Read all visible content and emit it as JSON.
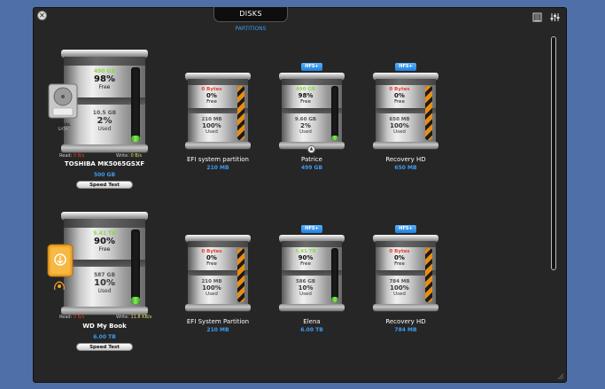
{
  "header": {
    "tab_disks": "DISKS",
    "tab_partitions": "PARTITIONS"
  },
  "colors": {
    "accent_blue": "#3e9bf0",
    "free_green": "#8cd84a",
    "warn_red": "#e04030",
    "stripe_orange": "#e88d14"
  },
  "icons": [
    "close-icon",
    "list-view-icon",
    "sliders-icon",
    "eject-icon",
    "hard-drive-icon",
    "external-drive-icon"
  ],
  "disks": [
    {
      "free_size": "490 GB",
      "free_pct": "98%",
      "free_word": "Free",
      "used_size": "10.5 GB",
      "used_pct": "2%",
      "used_word": "Used",
      "fill_level": 0.02,
      "icon_label_1": "SERIAL",
      "icon_label_2": "SATA",
      "read_label": "Read:",
      "read_value": "0 B/s",
      "write_label": "Write:",
      "write_value": "0 B/s",
      "name": "TOSHIBA MK5065GSXF",
      "capacity": "500 GB",
      "speed_test": "Speed Test"
    },
    {
      "free_size": "5.41 TB",
      "free_pct": "90%",
      "free_word": "Free",
      "used_size": "587 GB",
      "used_pct": "10%",
      "used_word": "Used",
      "fill_level": 0.1,
      "read_label": "Read:",
      "read_value": "0 B/s",
      "write_label": "Write:",
      "write_value": "11.8 KB/s",
      "name": "WD My Book",
      "capacity": "6.00 TB",
      "speed_test": "Speed Test"
    }
  ],
  "partitions": [
    [
      {
        "badge": "",
        "free_size": "0 Bytes",
        "free_pct": "0%",
        "free_word": "Free",
        "used_size": "210 MB",
        "used_pct": "100%",
        "used_word": "Used",
        "full": true,
        "name": "EFI system partition",
        "capacity": "210 MB"
      },
      {
        "badge": "HFS+",
        "free_size": "490 GB",
        "free_pct": "98%",
        "free_word": "Free",
        "used_size": "9.60 GB",
        "used_pct": "2%",
        "used_word": "Used",
        "full": false,
        "fill_level": 0.02,
        "name": "Patrice",
        "capacity": "499 GB",
        "eject": "▲"
      },
      {
        "badge": "HFS+",
        "free_size": "0 Bytes",
        "free_pct": "0%",
        "free_word": "Free",
        "used_size": "650 MB",
        "used_pct": "100%",
        "used_word": "Used",
        "full": true,
        "name": "Recovery HD",
        "capacity": "650 MB"
      }
    ],
    [
      {
        "badge": "",
        "free_size": "0 Bytes",
        "free_pct": "0%",
        "free_word": "Free",
        "used_size": "210 MB",
        "used_pct": "100%",
        "used_word": "Used",
        "full": true,
        "name": "EFI System Partition",
        "capacity": "210 MB"
      },
      {
        "badge": "HFS+",
        "free_size": "5.41 TB",
        "free_pct": "90%",
        "free_word": "Free",
        "used_size": "586 GB",
        "used_pct": "10%",
        "used_word": "Used",
        "full": false,
        "fill_level": 0.1,
        "name": "Elena",
        "capacity": "6.00 TB"
      },
      {
        "badge": "HFS+",
        "free_size": "0 Bytes",
        "free_pct": "0%",
        "free_word": "Free",
        "used_size": "784 MB",
        "used_pct": "100%",
        "used_word": "Used",
        "full": true,
        "name": "Recovery HD",
        "capacity": "784 MB"
      }
    ]
  ]
}
